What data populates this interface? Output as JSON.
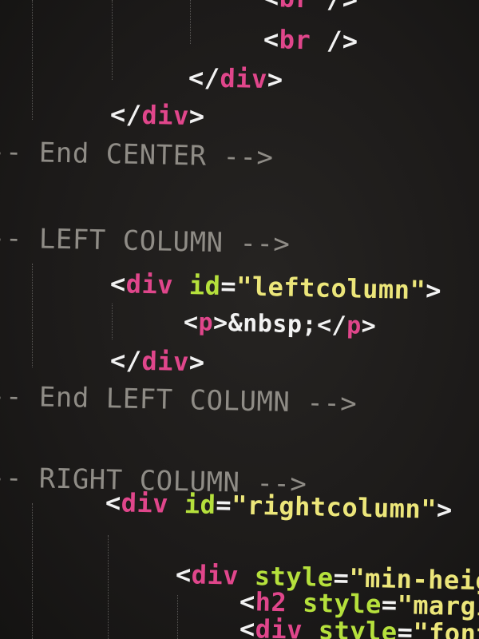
{
  "colors": {
    "background": "#1a1817",
    "text": "#f2f2f2",
    "tag": "#e0468b",
    "attribute": "#b5e03c",
    "string": "#ece67a",
    "comment": "#8f8c86",
    "indent_guide": "#5a5856"
  },
  "code": {
    "br_partial": [
      {
        "t": "<",
        "c": "w"
      },
      {
        "t": "br",
        "c": "m"
      },
      {
        "t": " />",
        "c": "w"
      }
    ],
    "br": [
      {
        "t": "<",
        "c": "w"
      },
      {
        "t": "br",
        "c": "m"
      },
      {
        "t": " />",
        "c": "w"
      }
    ],
    "div_close_1": [
      {
        "t": "</",
        "c": "w"
      },
      {
        "t": "div",
        "c": "m"
      },
      {
        "t": ">",
        "c": "w"
      }
    ],
    "div_close_2": [
      {
        "t": "</",
        "c": "w"
      },
      {
        "t": "div",
        "c": "m"
      },
      {
        "t": ">",
        "c": "w"
      }
    ],
    "end_center_comment": [
      {
        "t": "-- End CENTER -->",
        "c": "c"
      }
    ],
    "left_column_comment": [
      {
        "t": "-- LEFT COLUMN -->",
        "c": "c"
      }
    ],
    "leftcolumn_div_open": [
      {
        "t": "<",
        "c": "w"
      },
      {
        "t": "div",
        "c": "m"
      },
      {
        "t": " ",
        "c": "w"
      },
      {
        "t": "id",
        "c": "g"
      },
      {
        "t": "=",
        "c": "w"
      },
      {
        "t": "\"leftcolumn\"",
        "c": "y"
      },
      {
        "t": ">",
        "c": "w"
      }
    ],
    "nbsp_paragraph": [
      {
        "t": "<",
        "c": "w"
      },
      {
        "t": "p",
        "c": "m"
      },
      {
        "t": ">&nbsp;</",
        "c": "w"
      },
      {
        "t": "p",
        "c": "m"
      },
      {
        "t": ">",
        "c": "w"
      }
    ],
    "div_close_3": [
      {
        "t": "</",
        "c": "w"
      },
      {
        "t": "div",
        "c": "m"
      },
      {
        "t": ">",
        "c": "w"
      }
    ],
    "end_left_column_comment": [
      {
        "t": "-- End LEFT COLUMN -->",
        "c": "c"
      }
    ],
    "right_column_comment": [
      {
        "t": "-- RIGHT COLUMN -->",
        "c": "c"
      }
    ],
    "rightcolumn_div_open": [
      {
        "t": "<",
        "c": "w"
      },
      {
        "t": "div",
        "c": "m"
      },
      {
        "t": " ",
        "c": "w"
      },
      {
        "t": "id",
        "c": "g"
      },
      {
        "t": "=",
        "c": "w"
      },
      {
        "t": "\"rightcolumn\"",
        "c": "y"
      },
      {
        "t": ">",
        "c": "w"
      }
    ],
    "div_style_open": [
      {
        "t": "<",
        "c": "w"
      },
      {
        "t": "div",
        "c": "m"
      },
      {
        "t": " ",
        "c": "w"
      },
      {
        "t": "style",
        "c": "g"
      },
      {
        "t": "=",
        "c": "w"
      },
      {
        "t": "\"min-heig",
        "c": "y"
      }
    ],
    "h2_style_open": [
      {
        "t": "<",
        "c": "w"
      },
      {
        "t": "h2",
        "c": "m"
      },
      {
        "t": " ",
        "c": "w"
      },
      {
        "t": "style",
        "c": "g"
      },
      {
        "t": "=",
        "c": "w"
      },
      {
        "t": "\"margi",
        "c": "y"
      }
    ],
    "div_style_font_partial": [
      {
        "t": "<",
        "c": "w"
      },
      {
        "t": "div",
        "c": "m"
      },
      {
        "t": " ",
        "c": "w"
      },
      {
        "t": "style",
        "c": "g"
      },
      {
        "t": "=",
        "c": "w"
      },
      {
        "t": "\"font-",
        "c": "y"
      }
    ]
  }
}
